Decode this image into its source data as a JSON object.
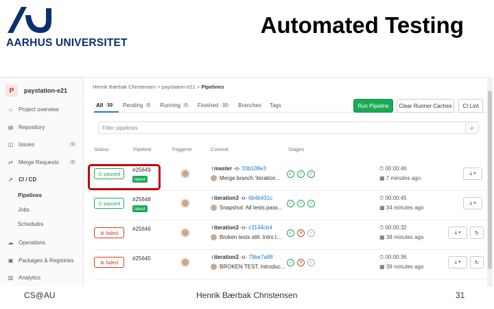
{
  "slide": {
    "title": "Automated Testing",
    "logo_text": "AARHUS UNIVERSITET",
    "footer_left": "CS@AU",
    "footer_center": "Henrik Bærbak Christensen",
    "page_number": "31"
  },
  "project": {
    "avatar": "P",
    "name": "paystation-e21"
  },
  "sidebar": [
    {
      "label": "Project overview",
      "icon": "home-icon"
    },
    {
      "label": "Repository",
      "icon": "book-icon"
    },
    {
      "label": "Issues",
      "icon": "issues-icon",
      "count": "0"
    },
    {
      "label": "Merge Requests",
      "icon": "merge-icon",
      "count": "0"
    },
    {
      "label": "CI / CD",
      "icon": "rocket-icon"
    },
    {
      "label": "Pipelines"
    },
    {
      "label": "Jobs"
    },
    {
      "label": "Schedules"
    },
    {
      "label": "Operations",
      "icon": "cloud-icon"
    },
    {
      "label": "Packages & Registries",
      "icon": "package-icon"
    },
    {
      "label": "Analytics",
      "icon": "chart-icon"
    }
  ],
  "breadcrumb": {
    "owner": "Henrik Bærbak Christensen",
    "project": "paystation-e21",
    "page": "Pipelines"
  },
  "tabs": [
    {
      "label": "All",
      "count": "10"
    },
    {
      "label": "Pending",
      "count": "0"
    },
    {
      "label": "Running",
      "count": "0"
    },
    {
      "label": "Finished",
      "count": "10"
    },
    {
      "label": "Branches"
    },
    {
      "label": "Tags"
    }
  ],
  "buttons": {
    "run": "Run Pipeline",
    "clear": "Clear Runner Caches",
    "lint": "CI Lint"
  },
  "filter_placeholder": "Filter pipelines",
  "columns": [
    "Status",
    "Pipeline",
    "Triggerer",
    "Commit",
    "Stages"
  ],
  "pipelines": [
    {
      "status": "passed",
      "id": "#25649",
      "latest": "latest",
      "ref": "master",
      "sha": "33b108e3",
      "message": "Merge branch 'iteration...",
      "duration": "00:00:46",
      "finished": "7 minutes ago"
    },
    {
      "status": "passed",
      "id": "#25648",
      "latest": "latest",
      "ref": "iteration3",
      "sha": "6b4b431c",
      "message": "Snapshot: All tests pass...",
      "duration": "00:00:45",
      "finished": "34 minutes ago"
    },
    {
      "status": "failed",
      "id": "#25646",
      "latest": "",
      "ref": "iteration3",
      "sha": "c3144cb4",
      "message": "Broken tests still. Intro t...",
      "duration": "00:00:32",
      "finished": "38 minutes ago"
    },
    {
      "status": "failed",
      "id": "#25645",
      "latest": "",
      "ref": "iteration3",
      "sha": "79be7a88",
      "message": "BROKEN TEST. Introduc...",
      "duration": "00:00:36",
      "finished": "39 minutes ago"
    }
  ],
  "colors": {
    "success": "#1aaa55",
    "danger": "#db3b21",
    "link": "#1f78d1",
    "highlight": "#c0000e",
    "brand": "#0b2f6b"
  }
}
